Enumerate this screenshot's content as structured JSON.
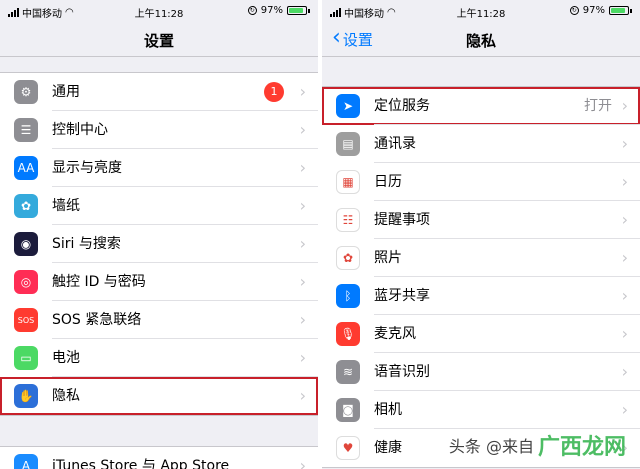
{
  "left": {
    "status": {
      "carrier": "中国移动",
      "time": "上午11:28",
      "battery": "97%"
    },
    "nav_title": "设置",
    "items": [
      {
        "label": "通用",
        "icon": "gear-icon",
        "color": "#8e8e93",
        "glyph": "⚙",
        "badge": "1"
      },
      {
        "label": "控制中心",
        "icon": "toggles-icon",
        "color": "#8e8e93",
        "glyph": "☰"
      },
      {
        "label": "显示与亮度",
        "icon": "text-size-icon",
        "color": "#007aff",
        "glyph": "AA"
      },
      {
        "label": "墙纸",
        "icon": "flower-icon",
        "color": "#34aadc",
        "glyph": "✿"
      },
      {
        "label": "Siri 与搜索",
        "icon": "siri-icon",
        "color": "#1c1c3c",
        "glyph": "◉"
      },
      {
        "label": "触控 ID 与密码",
        "icon": "fingerprint-icon",
        "color": "#ff2d55",
        "glyph": "◎"
      },
      {
        "label": "SOS 紧急联络",
        "icon": "sos-icon",
        "color": "#ff3b30",
        "glyph": "SOS"
      },
      {
        "label": "电池",
        "icon": "battery-icon",
        "color": "#4cd964",
        "glyph": "▭"
      },
      {
        "label": "隐私",
        "icon": "hand-icon",
        "color": "#2c6fd8",
        "glyph": "✋"
      }
    ],
    "bottom_item": {
      "label": "iTunes Store 与 App Store",
      "icon": "app-store-icon",
      "color": "#1a8cff",
      "glyph": "A"
    }
  },
  "right": {
    "status": {
      "carrier": "中国移动",
      "time": "上午11:28",
      "battery": "97%"
    },
    "back_label": "设置",
    "nav_title": "隐私",
    "items": [
      {
        "label": "定位服务",
        "value": "打开",
        "icon": "location-arrow-icon",
        "color": "#007aff",
        "glyph": "➤"
      },
      {
        "label": "通讯录",
        "icon": "contacts-icon",
        "color": "#9e9e9e",
        "glyph": "▤"
      },
      {
        "label": "日历",
        "icon": "calendar-icon",
        "color": "#ffffff",
        "glyph": "▦",
        "dark": true
      },
      {
        "label": "提醒事项",
        "icon": "reminders-icon",
        "color": "#ffffff",
        "glyph": "☷",
        "dark": true
      },
      {
        "label": "照片",
        "icon": "photos-icon",
        "color": "#ffffff",
        "glyph": "✿",
        "dark": true
      },
      {
        "label": "蓝牙共享",
        "icon": "bluetooth-icon",
        "color": "#007aff",
        "glyph": "ᛒ"
      },
      {
        "label": "麦克风",
        "icon": "microphone-icon",
        "color": "#ff3b30",
        "glyph": "🎙"
      },
      {
        "label": "语音识别",
        "icon": "waveform-icon",
        "color": "#8e8e93",
        "glyph": "≋"
      },
      {
        "label": "相机",
        "icon": "camera-icon",
        "color": "#8e8e93",
        "glyph": "◙"
      },
      {
        "label": "健康",
        "icon": "heart-icon",
        "color": "#ffffff",
        "glyph": "♥",
        "dark": true
      }
    ]
  },
  "watermark": {
    "prefix": "头条 @来自",
    "brand": "广西龙网"
  },
  "colors": {
    "highlight": "#c8202a",
    "accent": "#007aff"
  }
}
